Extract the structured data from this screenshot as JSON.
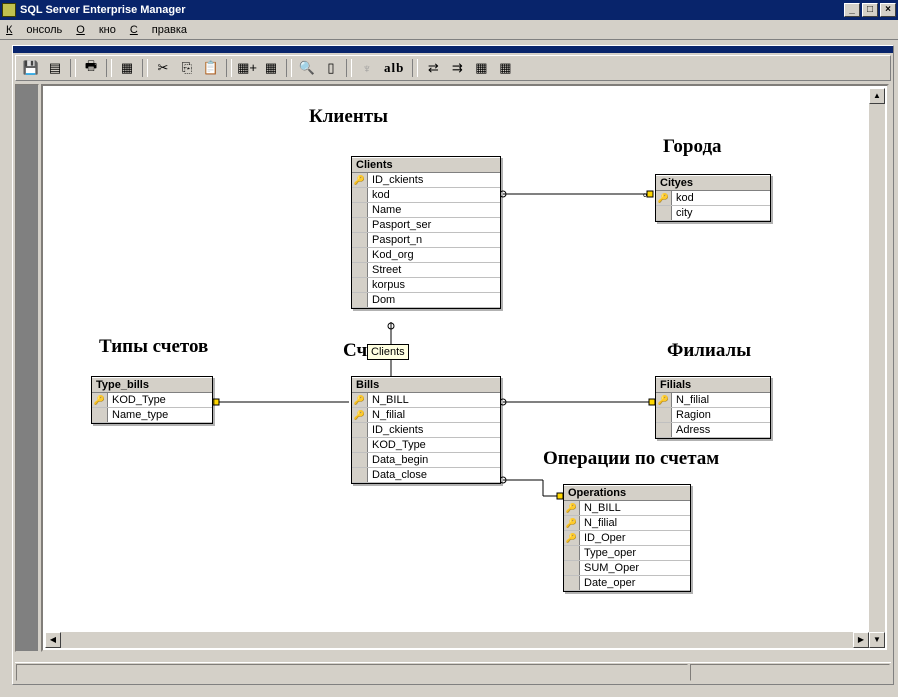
{
  "app": {
    "title": "SQL Server Enterprise Manager"
  },
  "menu": {
    "items": [
      "Консоль",
      "Окно",
      "Справка"
    ]
  },
  "toolbar": {
    "abc_label": "alb"
  },
  "captions": {
    "clients": "Клиенты",
    "cities": "Города",
    "bill_types": "Типы счетов",
    "bills_prefix": "Сч",
    "branches": "Филиалы",
    "operations": "Операции по счетам"
  },
  "tooltip": "Clients",
  "tables": {
    "clients": {
      "name": "Clients",
      "columns": [
        {
          "key": true,
          "name": "ID_ckients"
        },
        {
          "key": false,
          "name": "kod"
        },
        {
          "key": false,
          "name": "Name"
        },
        {
          "key": false,
          "name": "Pasport_ser"
        },
        {
          "key": false,
          "name": "Pasport_n"
        },
        {
          "key": false,
          "name": "Kod_org"
        },
        {
          "key": false,
          "name": "Street"
        },
        {
          "key": false,
          "name": "korpus"
        },
        {
          "key": false,
          "name": "Dom"
        }
      ]
    },
    "cityes": {
      "name": "Cityes",
      "columns": [
        {
          "key": true,
          "name": "kod"
        },
        {
          "key": false,
          "name": "city"
        }
      ]
    },
    "type_bills": {
      "name": "Type_bills",
      "columns": [
        {
          "key": true,
          "name": "KOD_Type"
        },
        {
          "key": false,
          "name": "Name_type"
        }
      ]
    },
    "bills": {
      "name": "Bills",
      "columns": [
        {
          "key": true,
          "name": "N_BILL"
        },
        {
          "key": true,
          "name": "N_filial"
        },
        {
          "key": false,
          "name": "ID_ckients"
        },
        {
          "key": false,
          "name": "KOD_Type"
        },
        {
          "key": false,
          "name": "Data_begin"
        },
        {
          "key": false,
          "name": "Data_close"
        }
      ]
    },
    "filials": {
      "name": "Filials",
      "columns": [
        {
          "key": true,
          "name": "N_filial"
        },
        {
          "key": false,
          "name": "Ragion"
        },
        {
          "key": false,
          "name": "Adress"
        }
      ]
    },
    "operations": {
      "name": "Operations",
      "columns": [
        {
          "key": true,
          "name": "N_BILL"
        },
        {
          "key": true,
          "name": "N_filial"
        },
        {
          "key": true,
          "name": "ID_Oper"
        },
        {
          "key": false,
          "name": "Type_oper"
        },
        {
          "key": false,
          "name": "SUM_Oper"
        },
        {
          "key": false,
          "name": "Date_oper"
        }
      ]
    }
  }
}
